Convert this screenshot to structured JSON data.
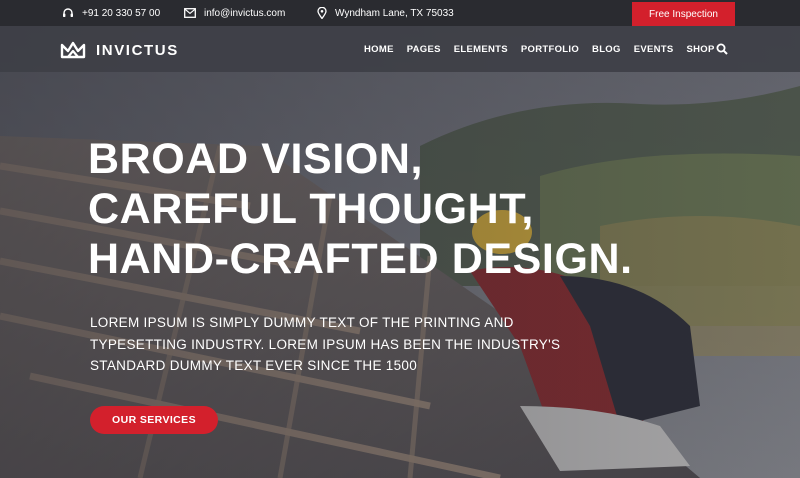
{
  "topbar": {
    "phone": "+91 20 330 57 00",
    "email": "info@invictus.com",
    "address": "Wyndham Lane, TX 75033",
    "cta_label": "Free Inspection",
    "icons": {
      "phone": "headset-icon",
      "email": "envelope-icon",
      "address": "map-pin-icon"
    }
  },
  "header": {
    "brand": "INVICTUS",
    "logo_icon": "crown-logo-icon",
    "nav": [
      {
        "label": "HOME"
      },
      {
        "label": "PAGES"
      },
      {
        "label": "ELEMENTS"
      },
      {
        "label": "PORTFOLIO"
      },
      {
        "label": "BLOG"
      },
      {
        "label": "EVENTS"
      },
      {
        "label": "SHOP"
      }
    ],
    "search_icon": "search-icon"
  },
  "hero": {
    "title_lines": [
      "BROAD VISION,",
      "CAREFUL THOUGHT,",
      "HAND-CRAFTED DESIGN."
    ],
    "subtitle": "LOREM IPSUM IS SIMPLY DUMMY TEXT OF THE PRINTING AND TYPESETTING INDUSTRY. LOREM IPSUM HAS BEEN THE INDUSTRY'S STANDARD DUMMY TEXT EVER SINCE THE 1500",
    "button_label": "OUR SERVICES"
  },
  "colors": {
    "accent": "#d3202c",
    "topbar_bg": "#2a2b30",
    "header_bg": "#3e3f46",
    "text": "#ffffff"
  }
}
